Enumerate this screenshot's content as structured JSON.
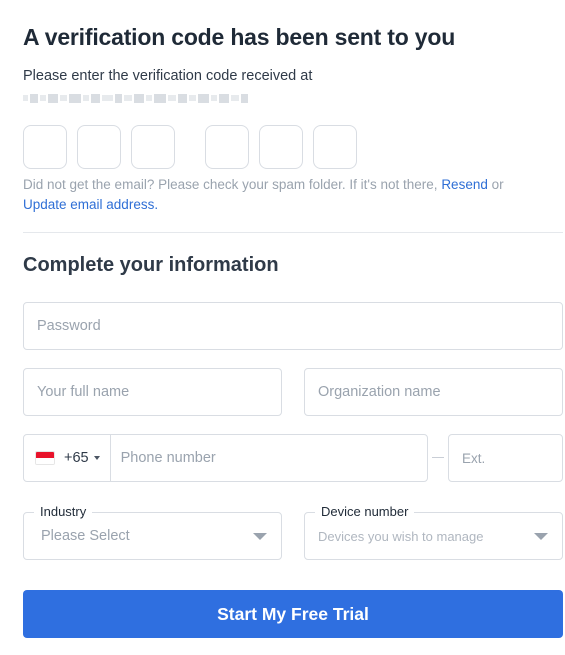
{
  "verification": {
    "title": "A verification code has been sent to you",
    "subtitle": "Please enter the verification code received at",
    "code_digits": [
      "",
      "",
      "",
      "",
      "",
      ""
    ],
    "help_prefix": "Did not get the email? Please check your spam folder. If it's not there,",
    "resend_label": "Resend",
    "help_or": "or",
    "update_email_label": "Update email address."
  },
  "info": {
    "section_title": "Complete your information",
    "password_placeholder": "Password",
    "fullname_placeholder": "Your full name",
    "organization_placeholder": "Organization name",
    "phone": {
      "country_flag": "singapore-flag-icon",
      "country_code": "+65",
      "placeholder": "Phone number",
      "ext_placeholder": "Ext."
    },
    "industry": {
      "label": "Industry",
      "value": "Please Select"
    },
    "device": {
      "label": "Device number",
      "value": "Devices you wish to manage"
    }
  },
  "cta": {
    "label": "Start My Free Trial",
    "color": "#2f6fe0"
  }
}
